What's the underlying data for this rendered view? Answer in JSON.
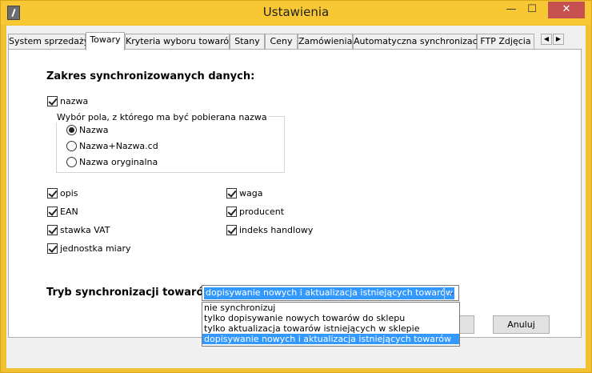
{
  "window": {
    "title": "Ustawienia",
    "minimize": "—",
    "maximize": "☐",
    "close": "✕"
  },
  "tabs": [
    {
      "label": "System sprzedaży"
    },
    {
      "label": "Towary"
    },
    {
      "label": "Kryteria wyboru towarów"
    },
    {
      "label": "Stany"
    },
    {
      "label": "Ceny"
    },
    {
      "label": "Zamówienia"
    },
    {
      "label": "Automatyczna synchronizacja"
    },
    {
      "label": "FTP Zdjęcia"
    }
  ],
  "tab_scroll": {
    "left": "◀",
    "right": "▶"
  },
  "panel": {
    "section_title": "Zakres synchronizowanych danych:",
    "nazwa_checkbox": {
      "label": "nazwa",
      "checked": true
    },
    "name_source_group": {
      "legend": "Wybór pola, z którego ma być pobierana nazwa",
      "options": [
        {
          "label": "Nazwa",
          "selected": true
        },
        {
          "label": "Nazwa+Nazwa.cd",
          "selected": false
        },
        {
          "label": "Nazwa oryginalna",
          "selected": false
        }
      ]
    },
    "left_checkboxes": [
      {
        "label": "opis",
        "checked": true
      },
      {
        "label": "EAN",
        "checked": true
      },
      {
        "label": "stawka VAT",
        "checked": true
      },
      {
        "label": "jednostka miary",
        "checked": true
      }
    ],
    "right_checkboxes": [
      {
        "label": "waga",
        "checked": true
      },
      {
        "label": "producent",
        "checked": true
      },
      {
        "label": "indeks handlowy",
        "checked": true
      }
    ],
    "sync_mode": {
      "label": "Tryb synchronizacji towarów:",
      "selected": "dopisywanie nowych i aktualizacja istniejących towarów",
      "options": [
        "nie synchronizuj",
        "tylko dopisywanie nowych towarów do sklepu",
        "tylko aktualizacja towarów istniejących w sklepie",
        "dopisywanie nowych i aktualizacja istniejących towarów"
      ]
    }
  },
  "buttons": {
    "cancel": "Anuluj"
  }
}
